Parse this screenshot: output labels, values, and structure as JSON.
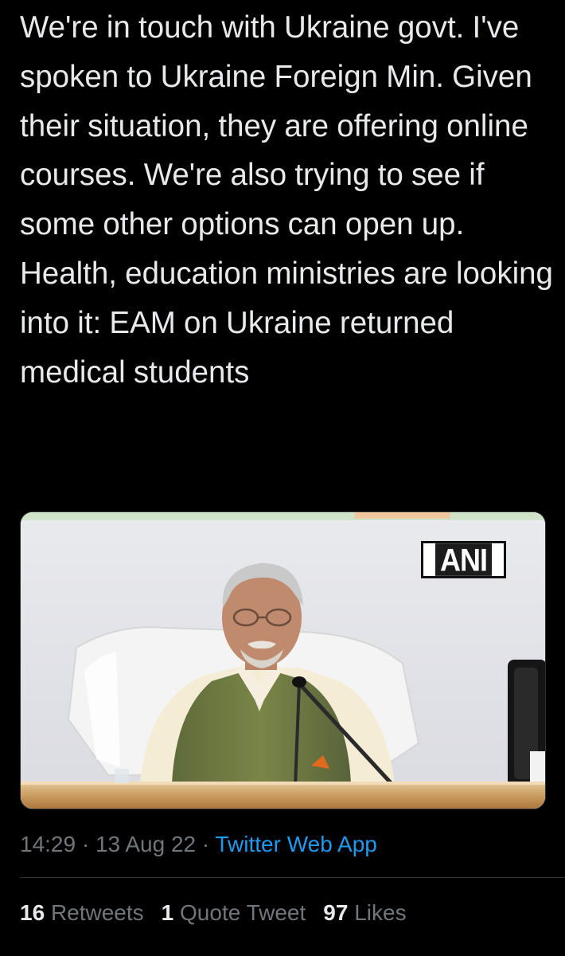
{
  "tweet": {
    "text": "We're in touch with Ukraine govt. I've spoken to Ukraine Foreign Min. Given their situation, they are offering online courses. We're also trying to see if some other options can open up. Health, education ministries are looking into it: EAM on Ukraine returned medical students",
    "media": {
      "watermark": "ANI"
    },
    "time": "14:29",
    "separator": "·",
    "date": "13 Aug 22",
    "source": "Twitter Web App"
  },
  "stats": {
    "retweets_count": "16",
    "retweets_label": "Retweets",
    "quotes_count": "1",
    "quotes_label": "Quote Tweet",
    "likes_count": "97",
    "likes_label": "Likes"
  },
  "colors": {
    "background": "#000000",
    "text": "#e7e9ea",
    "muted": "#71767b",
    "link": "#1d9bf0",
    "divider": "#2f3336"
  }
}
